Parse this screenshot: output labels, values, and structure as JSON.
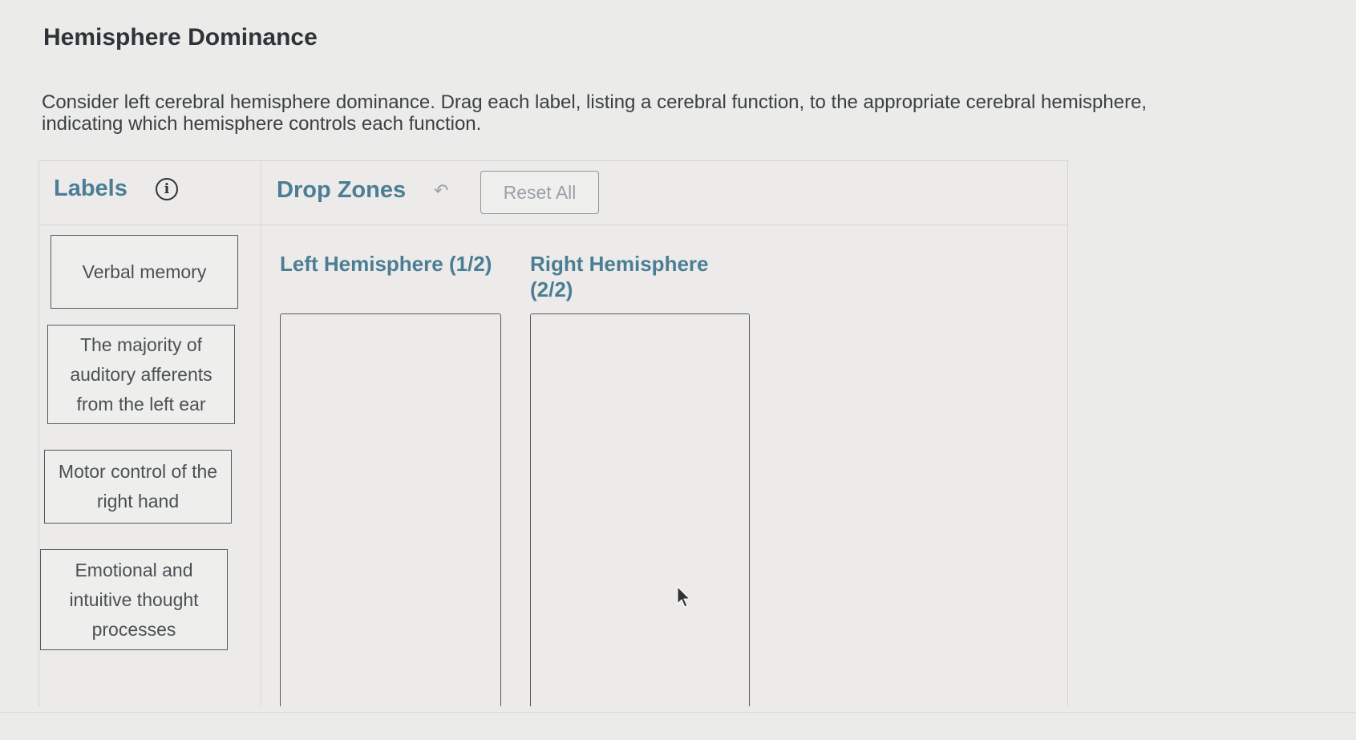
{
  "page": {
    "title": "Hemisphere Dominance",
    "instructions": "Consider left cerebral hemisphere dominance. Drag each label, listing a cerebral function, to the appropriate cerebral hemisphere, indicating which hemisphere controls each function."
  },
  "labels_panel": {
    "heading": "Labels",
    "info_icon": "info-circle-icon",
    "items": [
      "Verbal memory",
      "The majority of auditory afferents from the left ear",
      "Motor control of the right hand",
      "Emotional and intuitive thought processes"
    ]
  },
  "drop_zones_panel": {
    "heading": "Drop Zones",
    "undo_icon": "undo-arrow-icon",
    "reset_label": "Reset All",
    "zones": [
      {
        "title": "Left Hemisphere (1/2)"
      },
      {
        "title": "Right Hemisphere (2/2)"
      }
    ]
  },
  "colors": {
    "accent": "#4b7e94",
    "background": "#ebebea",
    "border": "#545a5f"
  }
}
